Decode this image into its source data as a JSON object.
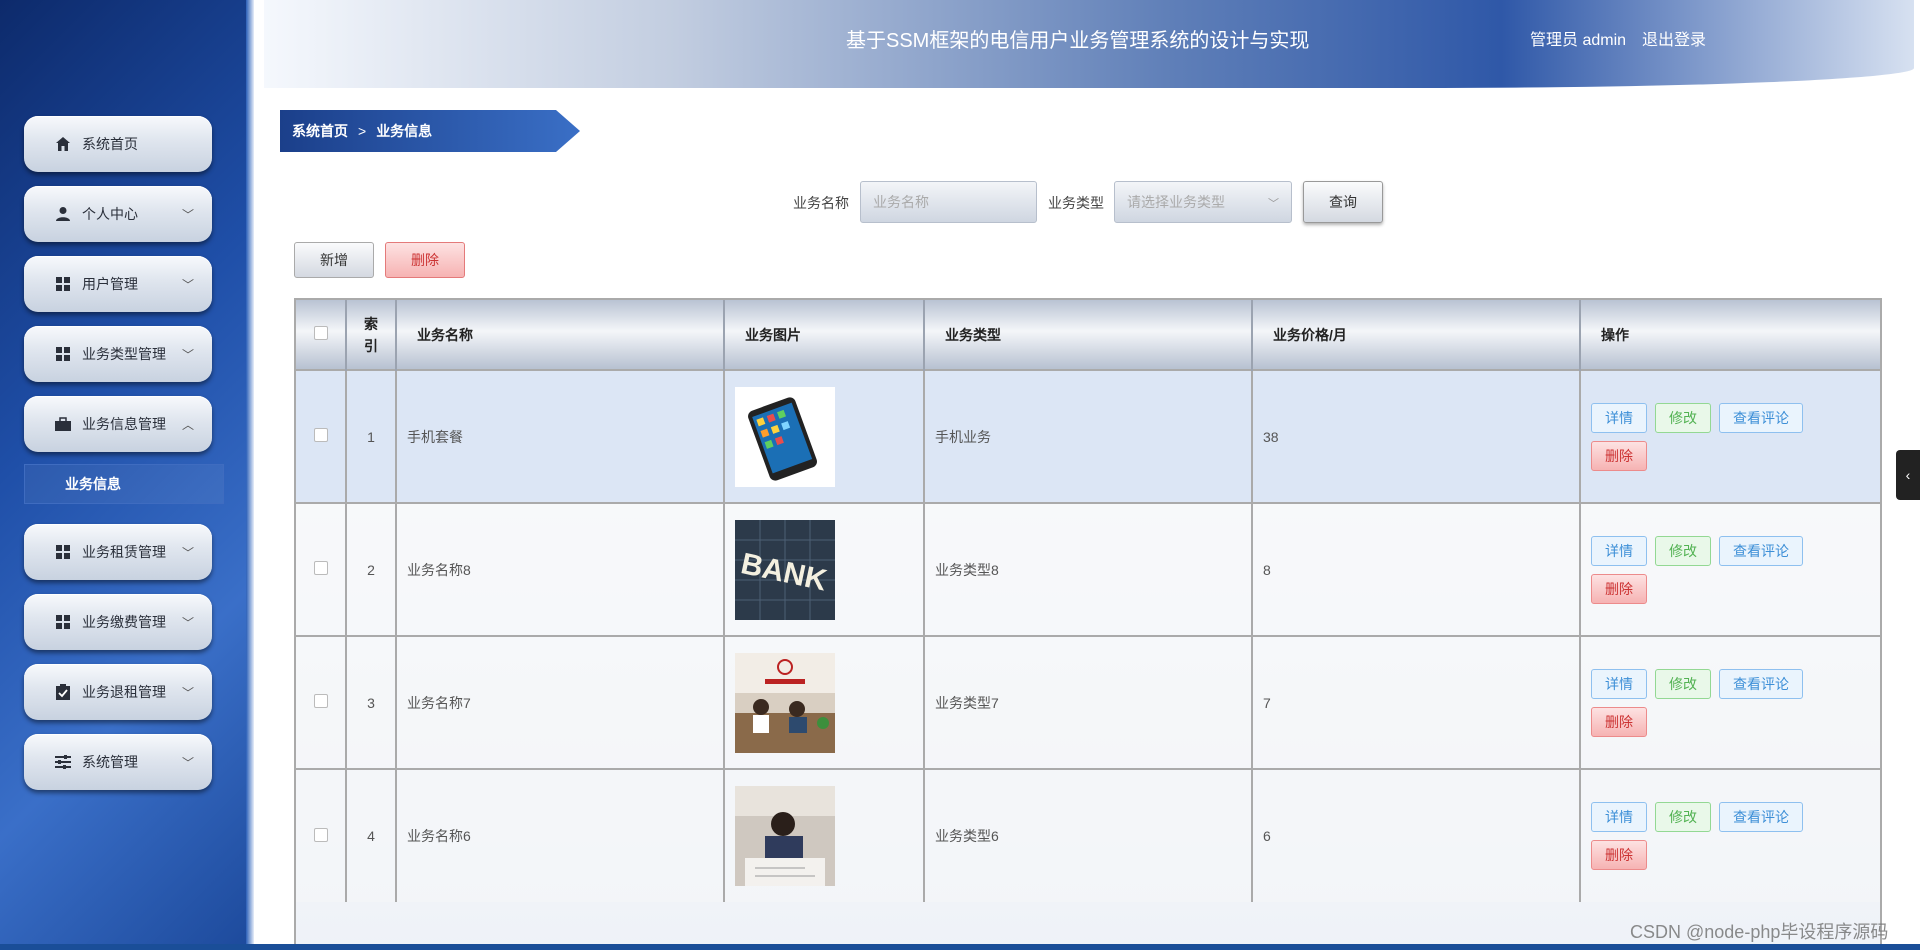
{
  "header": {
    "title": "基于SSM框架的电信用户业务管理系统的设计与实现",
    "user": "管理员 admin",
    "logout": "退出登录"
  },
  "sidebar": {
    "items": [
      {
        "label": "系统首页",
        "icon": "home-icon",
        "expandable": false
      },
      {
        "label": "个人中心",
        "icon": "user-icon",
        "expandable": true
      },
      {
        "label": "用户管理",
        "icon": "grid-icon",
        "expandable": true
      },
      {
        "label": "业务类型管理",
        "icon": "grid-icon",
        "expandable": true
      },
      {
        "label": "业务信息管理",
        "icon": "briefcase-icon",
        "expandable": true,
        "expanded": true
      },
      {
        "label": "业务租赁管理",
        "icon": "grid-icon",
        "expandable": true
      },
      {
        "label": "业务缴费管理",
        "icon": "grid-icon",
        "expandable": true
      },
      {
        "label": "业务退租管理",
        "icon": "clipboard-icon",
        "expandable": true
      },
      {
        "label": "系统管理",
        "icon": "sliders-icon",
        "expandable": true
      }
    ],
    "submenu_active": "业务信息"
  },
  "breadcrumb": {
    "home": "系统首页",
    "separator": ">",
    "current": "业务信息"
  },
  "search": {
    "name_label": "业务名称",
    "name_placeholder": "业务名称",
    "type_label": "业务类型",
    "type_placeholder": "请选择业务类型",
    "query_button": "查询"
  },
  "toolbar": {
    "add": "新增",
    "delete": "删除"
  },
  "table": {
    "headers": {
      "index": "索引",
      "name": "业务名称",
      "image": "业务图片",
      "type": "业务类型",
      "price": "业务价格/月",
      "ops": "操作"
    },
    "rows": [
      {
        "index": "1",
        "name": "手机套餐",
        "image": "smartphone",
        "type": "手机业务",
        "price": "38"
      },
      {
        "index": "2",
        "name": "业务名称8",
        "image": "bank-sign",
        "type": "业务类型8",
        "price": "8"
      },
      {
        "index": "3",
        "name": "业务名称7",
        "image": "bank-counter",
        "type": "业务类型7",
        "price": "7"
      },
      {
        "index": "4",
        "name": "业务名称6",
        "image": "office-worker",
        "type": "业务类型6",
        "price": "6"
      }
    ],
    "op_labels": {
      "detail": "详情",
      "edit": "修改",
      "review": "查看评论",
      "del": "删除"
    }
  },
  "image_text": {
    "bank_sign": "BANK"
  },
  "watermark": "CSDN @node-php毕设程序源码",
  "colors": {
    "sidebar_dark": "#0d2a6b",
    "accent_blue": "#2f58a8",
    "danger": "#c33",
    "success": "#52b252",
    "info": "#3d8fd7"
  }
}
